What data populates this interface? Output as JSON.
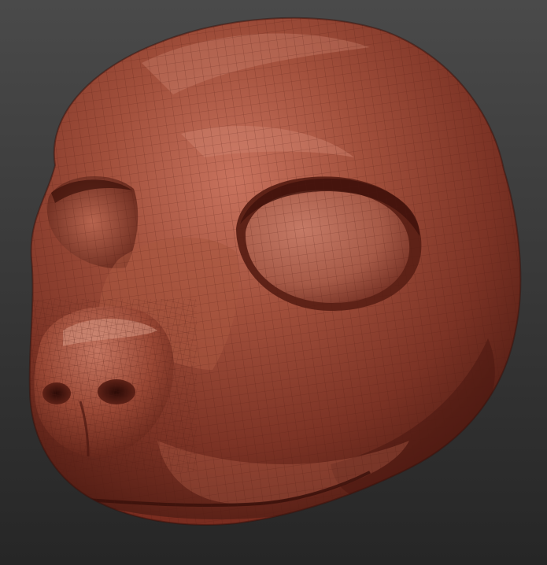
{
  "viewport": {
    "background_top": "#4a4a4a",
    "background_bottom": "#262626"
  },
  "model": {
    "subject": "sculpted-animal-head",
    "material_base": "#8a3a2c",
    "material_highlight": "#c8735e",
    "material_shadow": "#3e140f",
    "wireframe_color": "#5a2219",
    "wireframe_visible": true
  }
}
